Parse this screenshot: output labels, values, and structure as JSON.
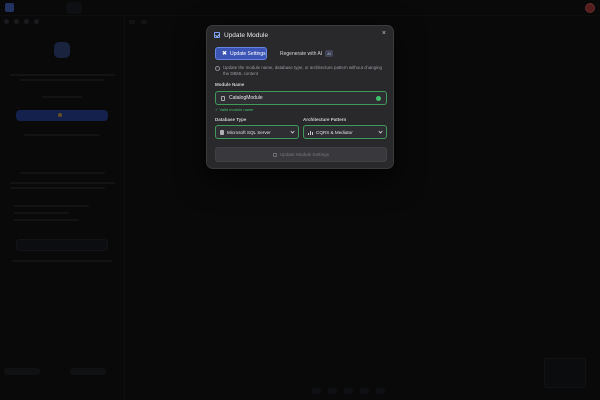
{
  "modal": {
    "title": "Update Module",
    "title_icon": "edit-square-icon",
    "close_icon": "close-icon",
    "close_glyph": "×",
    "tabs": [
      {
        "label": "Update Settings",
        "icon": "close-x-icon",
        "active": true
      },
      {
        "label": "Regenerate with AI",
        "icon": "cloud-icon",
        "badge": "AI",
        "active": false
      }
    ],
    "info_text": "Update the module name, database type, or architecture pattern without changing the DBML content",
    "module_name": {
      "label": "Module Name",
      "value": "CatalogModule",
      "validation": "✓ Valid module name"
    },
    "database_type": {
      "label": "Database Type",
      "value": "Microsoft SQL Server"
    },
    "architecture_pattern": {
      "label": "Architecture Pattern",
      "value": "CQRS & Mediator"
    },
    "submit_label": "Update Module Settings"
  },
  "colors": {
    "accent": "#3c55b5",
    "valid": "#3ec26a",
    "modal_bg": "#29292c",
    "backdrop": "#0d0d0f"
  }
}
